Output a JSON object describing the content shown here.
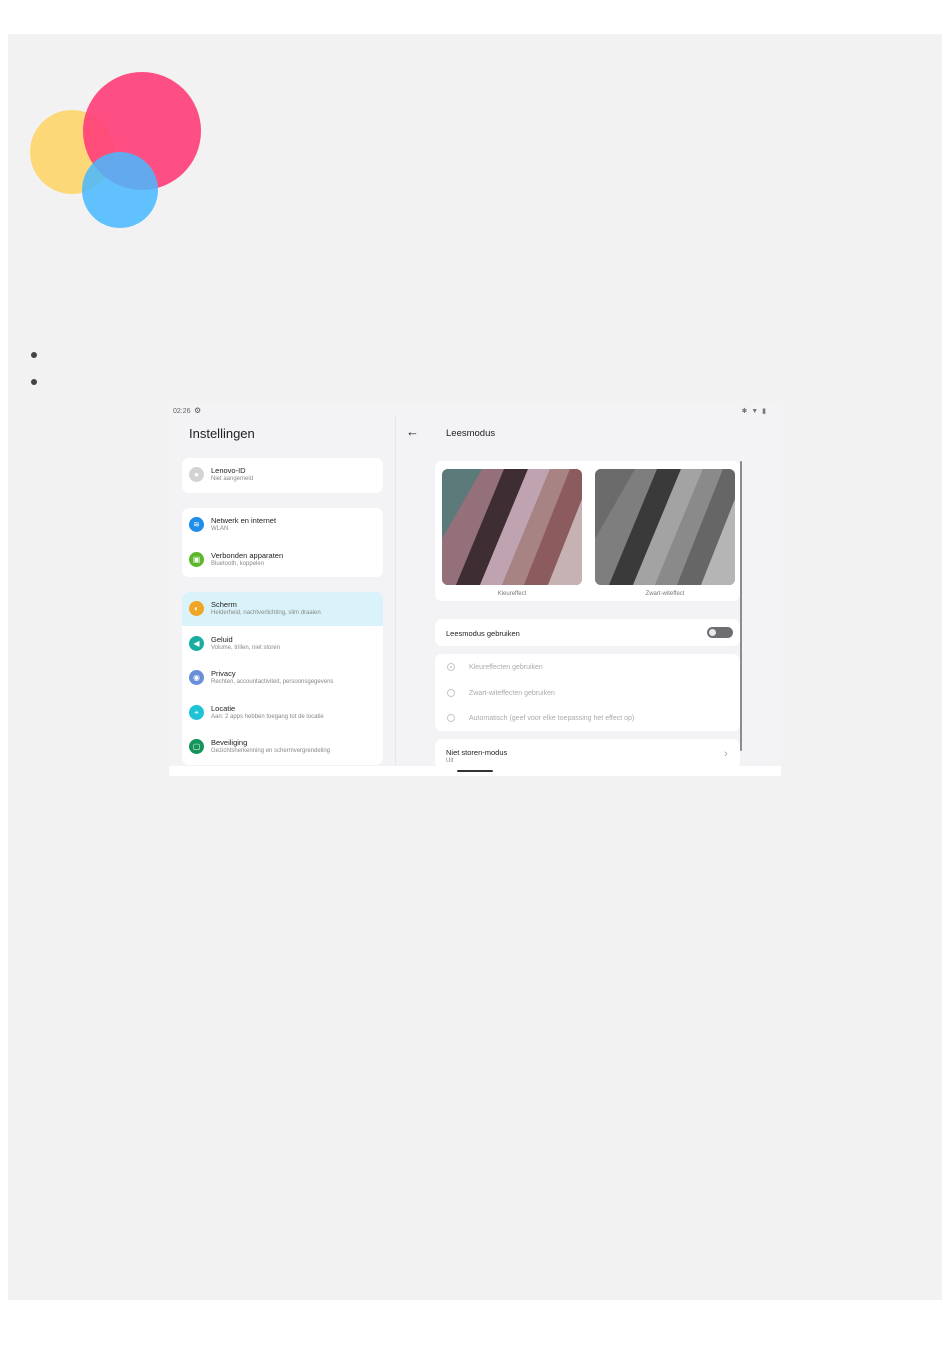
{
  "logo": {
    "circles": [
      {
        "name": "yellow-circle",
        "color": "#fdd56a"
      },
      {
        "name": "pink-circle",
        "color": "#ff3d78"
      },
      {
        "name": "blue-circle",
        "color": "#46b8ff"
      }
    ]
  },
  "screenshot": {
    "statusbar": {
      "time": "02:26",
      "icons": "✱ ▼ ▮"
    },
    "left": {
      "title": "Instellingen",
      "groups": [
        {
          "items": [
            {
              "name": "lenovo-id",
              "title": "Lenovo-ID",
              "sub": "Niet aangemeld",
              "icon": "avatar-icon",
              "color": "#d3d3d3",
              "glyph": "●"
            }
          ]
        },
        {
          "items": [
            {
              "name": "network",
              "title": "Netwerk en internet",
              "sub": "WLAN",
              "icon": "wifi-icon",
              "color": "#1e8ee8",
              "glyph": "≋"
            },
            {
              "name": "connected-devices",
              "title": "Verbonden apparaten",
              "sub": "Bluetooth, koppelen",
              "icon": "devices-icon",
              "color": "#5ab82a",
              "glyph": "▣"
            }
          ]
        },
        {
          "items": [
            {
              "name": "display",
              "title": "Scherm",
              "sub": "Helderheid, nachtverlichting, slim draaien",
              "icon": "display-icon",
              "color": "#f0a623",
              "glyph": "◐",
              "active": true
            },
            {
              "name": "sound",
              "title": "Geluid",
              "sub": "Volume, trillen, niet storen",
              "icon": "sound-icon",
              "color": "#17aea1",
              "glyph": "◀"
            },
            {
              "name": "privacy",
              "title": "Privacy",
              "sub": "Rechten, accountactiviteit, persoonsgegevens",
              "icon": "privacy-icon",
              "color": "#6a8fd8",
              "glyph": "◉"
            },
            {
              "name": "location",
              "title": "Locatie",
              "sub": "Aan: 2 apps hebben toegang tot de locatie",
              "icon": "location-icon",
              "color": "#1fc3d6",
              "glyph": "⌖"
            },
            {
              "name": "security",
              "title": "Beveiliging",
              "sub": "Gezichtsherkenning en schermvergrendeling",
              "icon": "lock-icon",
              "color": "#14935a",
              "glyph": "▢"
            }
          ]
        }
      ]
    },
    "right": {
      "back": "←",
      "title": "Leesmodus",
      "preview": {
        "color_label": "Kleureffect",
        "bw_label": "Zwart-witeffect"
      },
      "use_label": "Leesmodus gebruiken",
      "toggle_on": false,
      "options": [
        {
          "label": "Kleureffecten gebruiken",
          "selected": true
        },
        {
          "label": "Zwart-witeffecten gebruiken",
          "selected": false
        },
        {
          "label": "Automatisch (geef voor elke toepassing het effect op)",
          "selected": false
        }
      ],
      "dnd": {
        "title": "Niet storen-modus",
        "sub": "Uit",
        "chevron": "›"
      }
    }
  }
}
